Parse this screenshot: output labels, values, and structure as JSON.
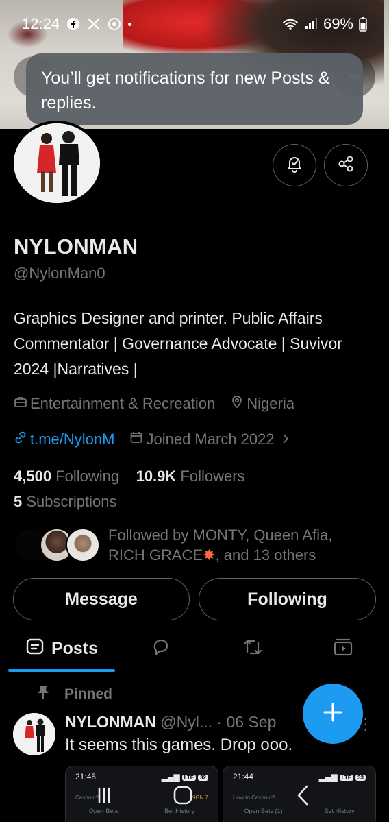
{
  "status_bar": {
    "time": "12:24",
    "battery": "69%"
  },
  "toast": {
    "message": "You’ll get notifications for new Posts & replies."
  },
  "profile": {
    "display_name": "NYLONMAN",
    "handle": "@NylonMan0",
    "bio": "Graphics Designer and printer. Public Affairs Commentator | Governance Advocate | Suvivor 2024 |Narratives |",
    "category": "Entertainment & Recreation",
    "location": "Nigeria",
    "link": "t.me/NylonM",
    "joined": "Joined March 2022",
    "following_count": "4,500",
    "following_label": "Following",
    "followers_count": "10.9K",
    "followers_label": "Followers",
    "subscriptions_count": "5",
    "subscriptions_label": "Subscriptions",
    "followed_by_line1": "Followed by MONTY, Queen Afia,",
    "followed_by_line2a": "RICH GRACE",
    "followed_by_line2b": ", and 13 others"
  },
  "actions": {
    "message": "Message",
    "following": "Following"
  },
  "tabs": {
    "posts": "Posts"
  },
  "post": {
    "pinned_label": "Pinned",
    "name": "NYLONMAN",
    "handle": "@Nyl...",
    "sep": " · ",
    "date": "06 Sep",
    "text": "It seems this games. Drop ooo."
  },
  "embedded": [
    {
      "time": "21:45",
      "lte": "32",
      "line": "Cashout?",
      "amount": "NGN 7",
      "left": "Open Bets",
      "right": "Bet History"
    },
    {
      "time": "21:44",
      "lte": "33",
      "line": "How to Cashout?",
      "amount": "",
      "left": "Open Bets (1)",
      "right": "Bet History"
    }
  ],
  "colors": {
    "accent": "#1d9bf0",
    "text": "#e7e9ea",
    "muted": "#71767b",
    "border": "#536471",
    "background": "#000000"
  },
  "icons": [
    "facebook-icon",
    "x-icon",
    "whatsapp-icon",
    "wifi-icon",
    "signal-icon",
    "battery-icon",
    "bell-check-icon",
    "share-icon",
    "briefcase-icon",
    "location-pin-icon",
    "link-icon",
    "calendar-icon",
    "chevron-right-icon",
    "posts-icon",
    "reply-icon",
    "repost-icon",
    "video-icon",
    "pin-icon",
    "plus-icon",
    "more-icon",
    "recent-apps-icon",
    "home-icon",
    "back-icon"
  ]
}
